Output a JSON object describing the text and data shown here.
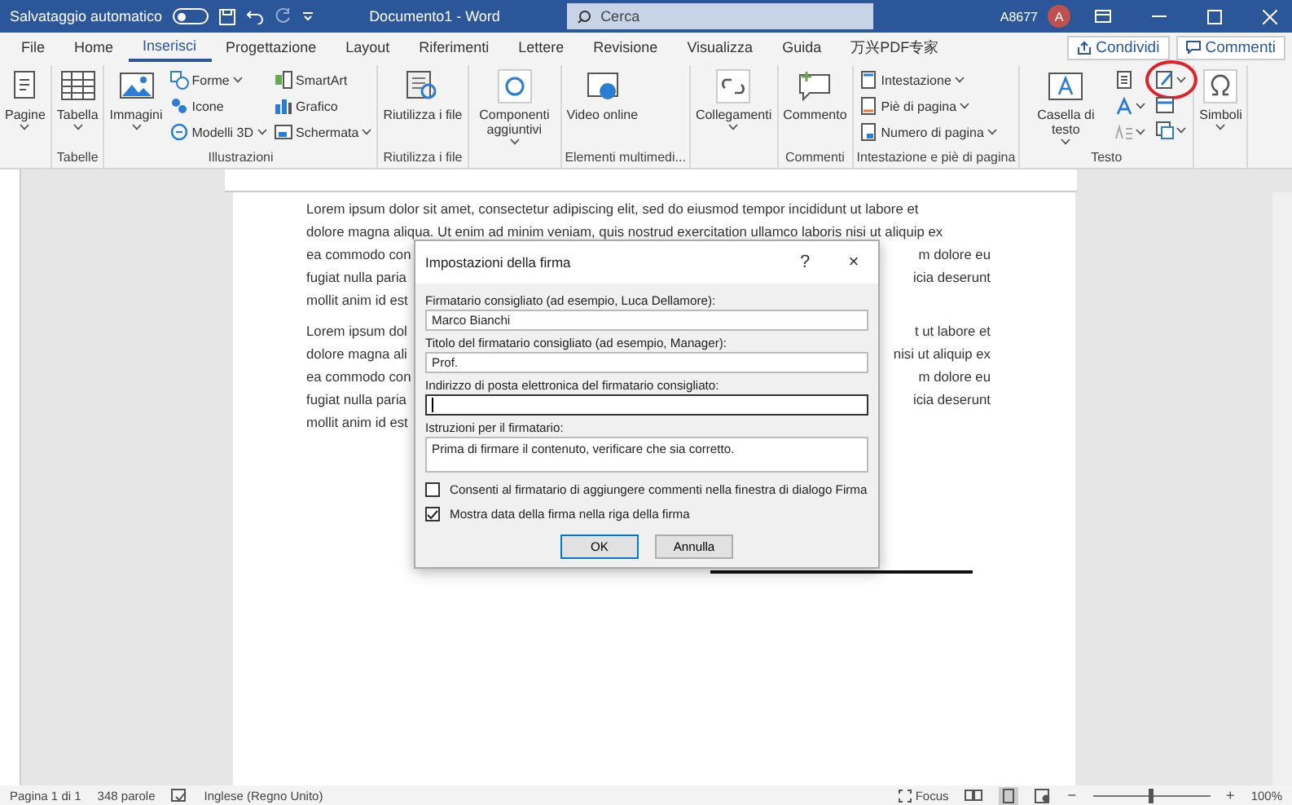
{
  "title_bar": {
    "autosave_label": "Salvataggio automatico",
    "autosave_on": false,
    "document_title": "Documento1 - Word",
    "search": {
      "placeholder": "Cerca"
    },
    "user": "A8677",
    "avatar": "A"
  },
  "tabs": [
    {
      "label": "File",
      "selected": false
    },
    {
      "label": "Home",
      "selected": false
    },
    {
      "label": "Inserisci",
      "selected": true
    },
    {
      "label": "Progettazione",
      "selected": false
    },
    {
      "label": "Layout",
      "selected": false
    },
    {
      "label": "Riferimenti",
      "selected": false
    },
    {
      "label": "Lettere",
      "selected": false
    },
    {
      "label": "Revisione",
      "selected": false
    },
    {
      "label": "Visualizza",
      "selected": false
    },
    {
      "label": "Guida",
      "selected": false
    },
    {
      "label": "万兴PDF专家",
      "selected": false
    }
  ],
  "share_button": "Condividi",
  "comments_button": "Commenti",
  "ribbon": [
    {
      "items": [
        {
          "kind": "large",
          "label": "Pagine",
          "dropdown": true
        }
      ]
    },
    {
      "label": "Tabelle",
      "items": [
        {
          "kind": "large",
          "label": "Tabella",
          "dropdown": true
        }
      ]
    },
    {
      "label": "Illustrazioni",
      "items": [
        {
          "kind": "large",
          "label": "Immagini",
          "dropdown": true
        },
        {
          "kind": "column",
          "entries": [
            {
              "label": "Forme",
              "dropdown": true
            },
            {
              "label": "Icone",
              "dropdown": false
            },
            {
              "label": "Modelli 3D",
              "dropdown": true
            }
          ]
        },
        {
          "kind": "column",
          "entries": [
            {
              "label": "SmartArt",
              "dropdown": false
            },
            {
              "label": "Grafico",
              "dropdown": false
            },
            {
              "label": "Schermata",
              "dropdown": true
            }
          ]
        }
      ]
    },
    {
      "label": "Riutilizza i file",
      "items": [
        {
          "kind": "large",
          "label": "Riutilizza i file",
          "dropdown": false
        }
      ]
    },
    {
      "items": [
        {
          "kind": "large",
          "label": "Componenti aggiuntivi",
          "dropdown": true
        }
      ]
    },
    {
      "label": "Elementi multimedi...",
      "items": [
        {
          "kind": "large",
          "label": "Video online",
          "dropdown": false
        }
      ]
    },
    {
      "items": [
        {
          "kind": "large",
          "label": "Collegamenti",
          "dropdown": true
        }
      ]
    },
    {
      "label": "Commenti",
      "items": [
        {
          "kind": "large",
          "label": "Commento",
          "dropdown": false
        }
      ]
    },
    {
      "label": "Intestazione e piè di pagina",
      "items": [
        {
          "kind": "column",
          "entries": [
            {
              "label": "Intestazione",
              "dropdown": true
            },
            {
              "label": "Piè di pagina",
              "dropdown": true
            },
            {
              "label": "Numero di pagina",
              "dropdown": true
            }
          ]
        }
      ]
    },
    {
      "label": "Testo",
      "items": [
        {
          "kind": "large",
          "label": "Casella di testo",
          "dropdown": true
        },
        {
          "kind": "icons",
          "entries": [
            {
              "dropdown": false,
              "circled": false
            },
            {
              "dropdown": true,
              "circled": false
            },
            {
              "dropdown": true,
              "circled": false
            }
          ]
        },
        {
          "kind": "icons",
          "entries": [
            {
              "dropdown": true,
              "circled": true
            },
            {
              "dropdown": false,
              "circled": false
            },
            {
              "dropdown": true,
              "circled": false
            }
          ]
        }
      ]
    },
    {
      "items": [
        {
          "kind": "large",
          "label": "Simboli",
          "dropdown": true
        }
      ]
    }
  ],
  "document": {
    "paragraphs": [
      [
        {
          "left": "Lorem ipsum dolor sit amet, consectetur adipiscing elit, sed do eiusmod tempor incididunt ut labore et"
        },
        {
          "left": "dolore magna aliqua. Ut enim ad minim veniam, quis nostrud exercitation ullamco laboris nisi ut aliquip ex"
        },
        {
          "left": "ea commodo con",
          "right": "m dolore eu"
        },
        {
          "left": "fugiat nulla paria",
          "right": "icia deserunt"
        },
        {
          "left": "mollit anim id est"
        }
      ],
      [
        {
          "left": "Lorem ipsum dol",
          "right": "t ut labore et"
        },
        {
          "left": "dolore magna ali",
          "right": "nisi ut aliquip ex"
        },
        {
          "left": "ea commodo con",
          "right": "m dolore eu"
        },
        {
          "left": "fugiat nulla paria",
          "right": "icia deserunt"
        },
        {
          "left": "mollit anim id est"
        }
      ]
    ]
  },
  "dialog": {
    "title": "Impostazioni della firma",
    "help": "?",
    "close": "×",
    "fields": [
      {
        "label": "Firmatario consigliato (ad esempio, Luca Dellamore):",
        "value": "Marco Bianchi",
        "kind": "line",
        "focused": false
      },
      {
        "label": "Titolo del firmatario consigliato (ad esempio, Manager):",
        "value": "Prof.",
        "kind": "line",
        "focused": false
      },
      {
        "label": "Indirizzo di posta elettronica del firmatario consigliato:",
        "kind": "line",
        "focused": true
      },
      {
        "label": "Istruzioni per il firmatario:",
        "value": "Prima di firmare il contenuto, verificare che sia corretto.",
        "kind": "area",
        "focused": false
      }
    ],
    "checkboxes": [
      {
        "label": "Consenti al firmatario di aggiungere commenti nella finestra di dialogo Firma",
        "checked": false
      },
      {
        "label": "Mostra data della firma nella riga della firma",
        "checked": true
      }
    ],
    "buttons": [
      {
        "label": "OK",
        "default": true
      },
      {
        "label": "Annulla",
        "default": false
      }
    ]
  },
  "status_bar": {
    "page": "Pagina 1 di 1",
    "words": "348 parole",
    "language": "Inglese (Regno Unito)",
    "focus": "Focus",
    "zoom_out": "−",
    "zoom_in": "+",
    "zoom": {
      "level": 0.5
    },
    "zoom_text": "100%"
  }
}
